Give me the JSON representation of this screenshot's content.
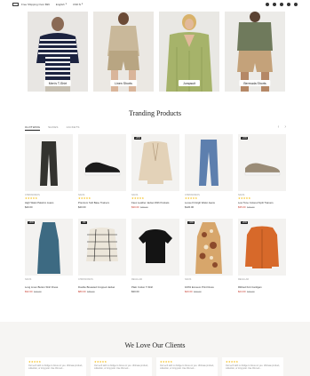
{
  "topbar": {
    "shipping_text": "Free Shipping Over $99",
    "language": "English",
    "currency": "USD $",
    "social": [
      "facebook-icon",
      "x-icon",
      "pinterest-icon",
      "instagram-icon",
      "youtube-icon"
    ]
  },
  "categories": [
    {
      "label": "Men's T-Shirt",
      "bg": "#e8e6e3"
    },
    {
      "label": "Linen Shorts",
      "bg": "#ebe8e3"
    },
    {
      "label": "Jumpsuit",
      "bg": "#e9e8e4"
    },
    {
      "label": "Bermuda Shorts",
      "bg": "#ecebe8"
    }
  ],
  "trending": {
    "title": "Tranding Products",
    "tabs": [
      "CLOTHING",
      "SHOES",
      "JACKETS"
    ],
    "active_tab": 0
  },
  "products_row1": [
    {
      "category": "CHRONOMOS",
      "stars": "★★★★★",
      "name": "High Waist Palazzo Jeans",
      "price": "$40.00",
      "old_price": "",
      "badge": "",
      "sale": false
    },
    {
      "category": "NAVIS",
      "stars": "★★★★★",
      "name": "Premium Soft Base Trainers",
      "price": "$40.00",
      "old_price": "",
      "badge": "",
      "sale": false
    },
    {
      "category": "NAVIS",
      "stars": "★★★★★",
      "name": "Faux Leather Jacket With Pockets",
      "price": "$30.00",
      "old_price": "$38.00",
      "badge": "-20%",
      "sale": true
    },
    {
      "category": "CHRONOMOS",
      "stars": "★★★★★",
      "name": "Loose Fit High Waist Jeans",
      "price": "$120.00",
      "old_price": "",
      "badge": "",
      "sale": false
    },
    {
      "category": "NAVIS",
      "stars": "★★★★★",
      "name": "Low Tone Colored Split Trainers",
      "price": "$35.00",
      "old_price": "$46.00",
      "badge": "-24%",
      "sale": true
    }
  ],
  "products_row2": [
    {
      "category": "NAVIS",
      "stars": "",
      "name": "Long Linen Button Shirt Dress",
      "price": "$32.00",
      "old_price": "$40.00",
      "badge": "-20%",
      "sale": true
    },
    {
      "category": "CHRONOMOS",
      "stars": "",
      "name": "Double Breasted Cropped Jacket",
      "price": "$80.00",
      "old_price": "$88.00",
      "badge": "-9%",
      "sale": true
    },
    {
      "category": "REGULAR",
      "stars": "",
      "name": "Plain Cotton T-Shirt",
      "price": "$30.00",
      "old_price": "",
      "badge": "",
      "sale": false
    },
    {
      "category": "NAVIS",
      "stars": "",
      "name": "100% Ecovero Print Dress",
      "price": "$20.00",
      "old_price": "$30.00",
      "badge": "-33%",
      "sale": true
    },
    {
      "category": "REGULAR",
      "stars": "",
      "name": "Ribbed Knit Cardigan",
      "price": "$24.00",
      "old_price": "$30.00",
      "badge": "-20%",
      "sale": true
    }
  ],
  "clients": {
    "title": "We Love Our Clients",
    "reviews": [
      {
        "stars": "★★★★★",
        "text": "Our tech with no bridge to focus on you. Ultimate product, collection, or long post. Use this text..."
      },
      {
        "stars": "★★★★★",
        "text": "Our tech with no bridge to focus on you. Ultimate product, collection, or long post. Use this text..."
      },
      {
        "stars": "★★★★★",
        "text": "Our tech with no bridge to focus on you. Ultimate product, collection, or long post. Use this text..."
      },
      {
        "stars": "★★★★★",
        "text": "Our tech with no bridge to focus on you. Ultimate product, collection, or long post. Use this text..."
      }
    ]
  }
}
